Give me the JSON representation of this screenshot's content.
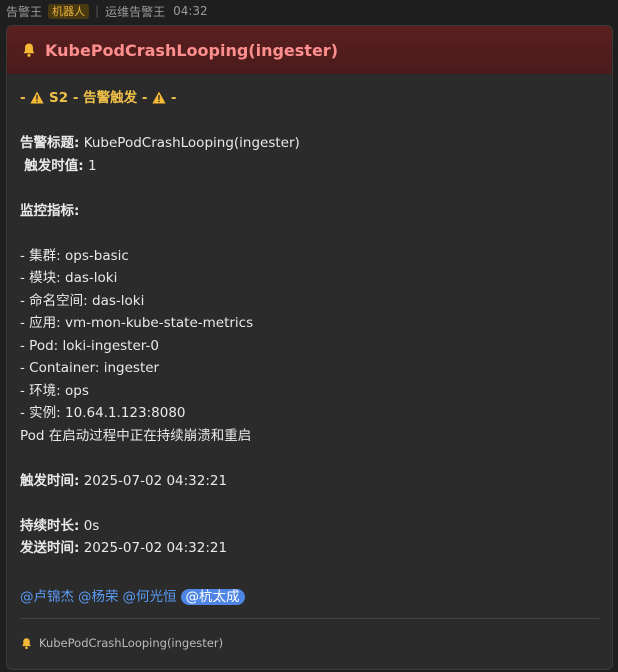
{
  "topbar": {
    "sender": "告警王",
    "bot_badge": "机器人",
    "group_sender": "运维告警王",
    "time": "04:32"
  },
  "card": {
    "title": "KubePodCrashLooping(ingester)",
    "severity_prefix": "- ",
    "severity_text": " S2 - 告警触发 - ",
    "severity_suffix": " -",
    "alert_title_label": "告警标题:",
    "alert_title_value": " KubePodCrashLooping(ingester)",
    "trigger_threshold_label": "触发时值:",
    "trigger_threshold_value": " 1",
    "metrics_label": "监控指标:",
    "metrics": [
      {
        "label": "- 集群:",
        "value": " ops-basic"
      },
      {
        "label": "- 模块:",
        "value": " das-loki"
      },
      {
        "label": "- 命名空间:",
        "value": " das-loki"
      },
      {
        "label": "- 应用:",
        "value": " vm-mon-kube-state-metrics"
      },
      {
        "label": "- Pod:",
        "value": " loki-ingester-0"
      },
      {
        "label": "- Container:",
        "value": " ingester"
      },
      {
        "label": "- 环境:",
        "value": " ops"
      },
      {
        "label": "- 实例:",
        "value": " 10.64.1.123:8080"
      }
    ],
    "description": "Pod 在启动过程中正在持续崩溃和重启",
    "trigger_time_label": "触发时间:",
    "trigger_time_value": " 2025-07-02 04:32:21",
    "duration_label": "持续时长:",
    "duration_value": " 0s",
    "send_time_label": "发送时间:",
    "send_time_value": " 2025-07-02 04:32:21",
    "mentions": [
      "@卢锦杰",
      "@杨荣",
      "@何光恒"
    ],
    "mention_self": "@杭太成",
    "footer_title": "KubePodCrashLooping(ingester)"
  },
  "colors": {
    "header_bg": "#5b1f1f",
    "title_color": "#ff8f8f",
    "severity_color": "#f0c04a",
    "mention_color": "#5b9cf5",
    "mention_self_bg": "#4f86e6"
  },
  "icons": {
    "bell": "bell-icon",
    "warning": "warning-icon"
  }
}
